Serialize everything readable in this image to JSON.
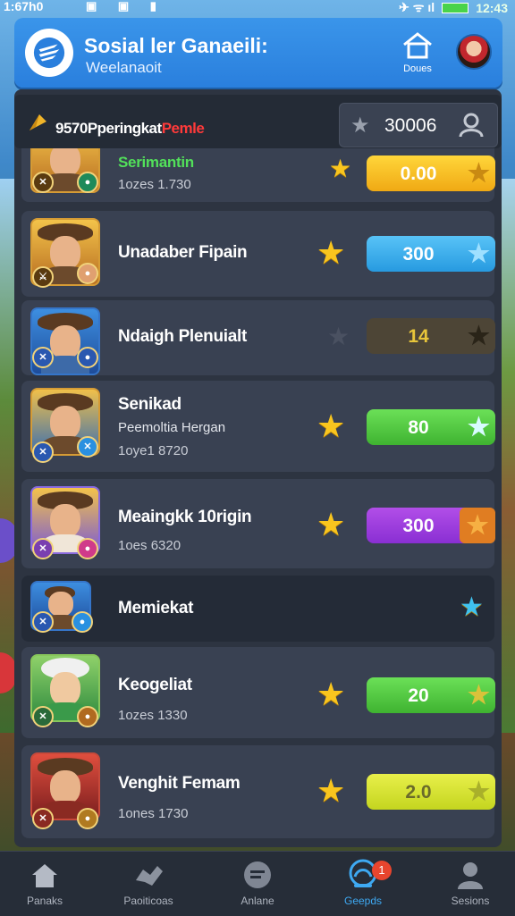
{
  "status_bar": {
    "time": "1:67h0",
    "right_text": "12:43",
    "icons": [
      "image-icon",
      "message-icon",
      "signal-icon",
      "wifi-icon",
      "battery-icon"
    ]
  },
  "header": {
    "title": "Sosial ler Ganaeili:",
    "subtitle": "Weelanaoit",
    "home_label": "Doues",
    "accent": "#2a7fdd"
  },
  "rank_bar": {
    "text_main": "9570Pperingkat",
    "text_red": "Pemle",
    "points": "30006"
  },
  "rows": [
    {
      "name": "Serimantin",
      "sub": "1ozes 1.730",
      "value": "0.00",
      "pill_color": "yellow",
      "portrait": "gold"
    },
    {
      "name": "Unadaber Fipain",
      "sub": "",
      "value": "300",
      "pill_color": "blue",
      "portrait": "gold"
    },
    {
      "name": "Ndaigh Plenuialt",
      "sub": "",
      "value": "14",
      "pill_color": "brown",
      "portrait": "blue"
    },
    {
      "name": "Senikad",
      "sub": "Peemoltia Hergan",
      "sub2": "1oye1 8720",
      "value": "80",
      "pill_color": "green",
      "portrait": "gold"
    },
    {
      "name": "Meaingkk 10rigin",
      "sub": "1oes 6320",
      "value": "300",
      "pill_color": "purple",
      "portrait": "gold"
    },
    {
      "name": "Memiekat",
      "sub": "",
      "value": "",
      "pill_color": "",
      "portrait": "blue"
    },
    {
      "name": "Keogeliat",
      "sub": "1ozes 1330",
      "value": "20",
      "pill_color": "green",
      "portrait": "green"
    },
    {
      "name": "Venghit Femam",
      "sub": "1ones 1730",
      "value": "2.0",
      "pill_color": "lime",
      "portrait": "red"
    }
  ],
  "bottom_nav": [
    {
      "label": "Panaks",
      "icon": "home-icon"
    },
    {
      "label": "Paoiticoas",
      "icon": "handshake-icon"
    },
    {
      "label": "Anlane",
      "icon": "chat-icon"
    },
    {
      "label": "Geepds",
      "icon": "groups-icon",
      "badge": "1"
    },
    {
      "label": "Sesions",
      "icon": "profile-icon"
    }
  ]
}
